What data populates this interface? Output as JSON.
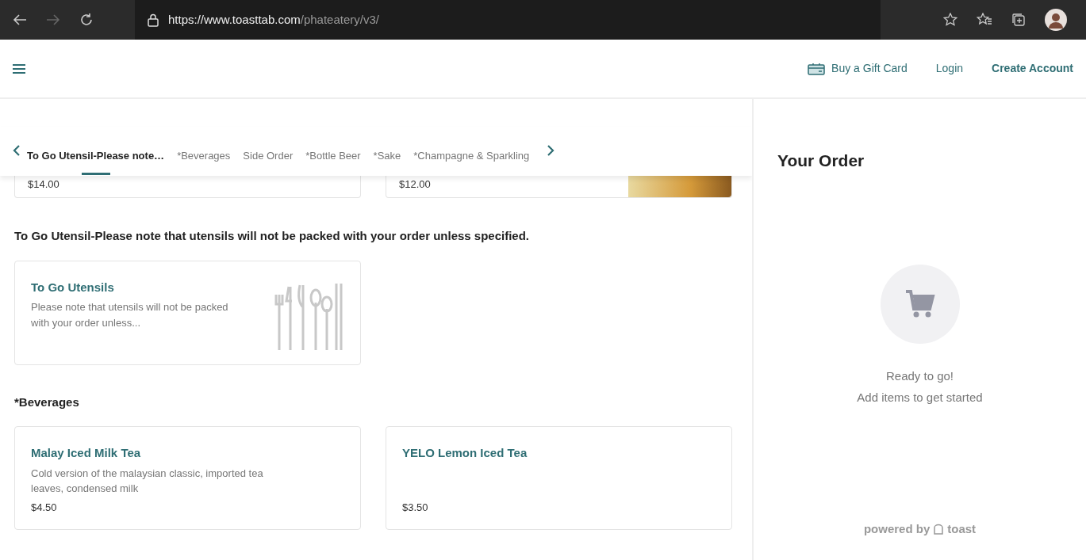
{
  "browser": {
    "url_host": "https://www.toasttab.com",
    "url_path": "/phateatery/v3/"
  },
  "header": {
    "links": [
      {
        "kind": "gift",
        "label": "Buy a Gift Card"
      },
      {
        "kind": "plain",
        "label": "Login"
      },
      {
        "kind": "strong",
        "label": "Create Account"
      }
    ]
  },
  "category_tabs": [
    {
      "label": "To Go Utensil-Please note…",
      "selected": true
    },
    {
      "label": "*Beverages",
      "selected": false
    },
    {
      "label": "Side Order",
      "selected": false
    },
    {
      "label": "*Bottle Beer",
      "selected": false
    },
    {
      "label": "*Sake",
      "selected": false
    },
    {
      "label": "*Champagne & Sparkling",
      "selected": false
    }
  ],
  "previous_items": [
    {
      "price": "$14.00",
      "has_image": false
    },
    {
      "price": "$12.00",
      "has_image": true
    }
  ],
  "sections": [
    {
      "title": "To Go Utensil-Please note that utensils will not be packed with your order unless specified.",
      "items": [
        {
          "name": "To Go Utensils",
          "description": "Please note that utensils will not be packed with your order unless...",
          "has_image": true
        }
      ]
    },
    {
      "title": "*Beverages",
      "items": [
        {
          "name": "Malay Iced Milk Tea",
          "description": "Cold version of the malaysian classic, imported tea leaves, condensed milk",
          "price": "$4.50",
          "has_image": false
        },
        {
          "name": "YELO Lemon Iced Tea",
          "price": "$3.50",
          "has_image": false
        }
      ]
    }
  ],
  "order": {
    "title": "Your Order",
    "empty_title": "Ready to go!",
    "empty_text": "Add items to get started",
    "powered_by": "powered by",
    "brand": "toast"
  }
}
